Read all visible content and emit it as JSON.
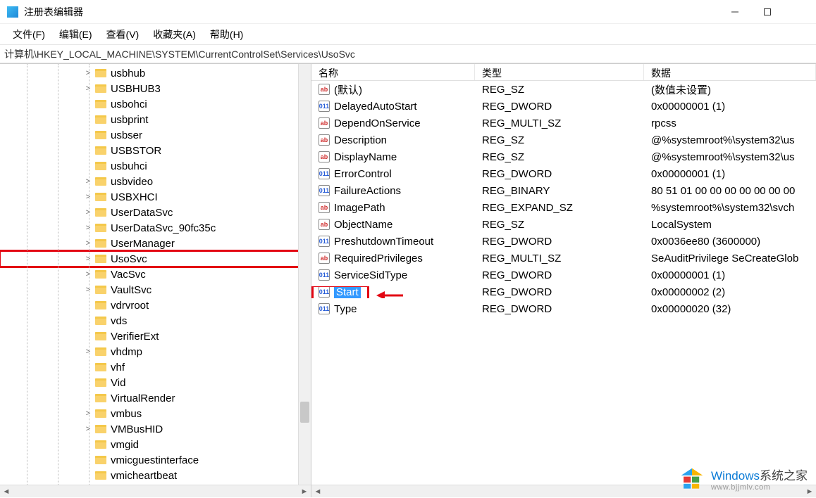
{
  "window": {
    "title": "注册表编辑器"
  },
  "menu": {
    "file": "文件(F)",
    "edit": "编辑(E)",
    "view": "查看(V)",
    "favorites": "收藏夹(A)",
    "help": "帮助(H)"
  },
  "address": "计算机\\HKEY_LOCAL_MACHINE\\SYSTEM\\CurrentControlSet\\Services\\UsoSvc",
  "tree": [
    {
      "label": "usbhub",
      "expander": ">"
    },
    {
      "label": "USBHUB3",
      "expander": ">"
    },
    {
      "label": "usbohci",
      "expander": ""
    },
    {
      "label": "usbprint",
      "expander": ""
    },
    {
      "label": "usbser",
      "expander": ""
    },
    {
      "label": "USBSTOR",
      "expander": ""
    },
    {
      "label": "usbuhci",
      "expander": ""
    },
    {
      "label": "usbvideo",
      "expander": ">"
    },
    {
      "label": "USBXHCI",
      "expander": ">"
    },
    {
      "label": "UserDataSvc",
      "expander": ">"
    },
    {
      "label": "UserDataSvc_90fc35c",
      "expander": ">"
    },
    {
      "label": "UserManager",
      "expander": ">"
    },
    {
      "label": "UsoSvc",
      "expander": ">",
      "highlighted": true
    },
    {
      "label": "VacSvc",
      "expander": ">"
    },
    {
      "label": "VaultSvc",
      "expander": ">"
    },
    {
      "label": "vdrvroot",
      "expander": ""
    },
    {
      "label": "vds",
      "expander": ""
    },
    {
      "label": "VerifierExt",
      "expander": ""
    },
    {
      "label": "vhdmp",
      "expander": ">"
    },
    {
      "label": "vhf",
      "expander": ""
    },
    {
      "label": "Vid",
      "expander": ""
    },
    {
      "label": "VirtualRender",
      "expander": ""
    },
    {
      "label": "vmbus",
      "expander": ">"
    },
    {
      "label": "VMBusHID",
      "expander": ">"
    },
    {
      "label": "vmgid",
      "expander": ""
    },
    {
      "label": "vmicguestinterface",
      "expander": ""
    },
    {
      "label": "vmicheartbeat",
      "expander": ""
    }
  ],
  "columns": {
    "name": "名称",
    "type": "类型",
    "data": "数据"
  },
  "values": [
    {
      "icon": "str",
      "name": "(默认)",
      "type": "REG_SZ",
      "data": "(数值未设置)"
    },
    {
      "icon": "bin",
      "name": "DelayedAutoStart",
      "type": "REG_DWORD",
      "data": "0x00000001 (1)"
    },
    {
      "icon": "str",
      "name": "DependOnService",
      "type": "REG_MULTI_SZ",
      "data": "rpcss"
    },
    {
      "icon": "str",
      "name": "Description",
      "type": "REG_SZ",
      "data": "@%systemroot%\\system32\\us"
    },
    {
      "icon": "str",
      "name": "DisplayName",
      "type": "REG_SZ",
      "data": "@%systemroot%\\system32\\us"
    },
    {
      "icon": "bin",
      "name": "ErrorControl",
      "type": "REG_DWORD",
      "data": "0x00000001 (1)"
    },
    {
      "icon": "bin",
      "name": "FailureActions",
      "type": "REG_BINARY",
      "data": "80 51 01 00 00 00 00 00 00 00"
    },
    {
      "icon": "str",
      "name": "ImagePath",
      "type": "REG_EXPAND_SZ",
      "data": "%systemroot%\\system32\\svch"
    },
    {
      "icon": "str",
      "name": "ObjectName",
      "type": "REG_SZ",
      "data": "LocalSystem"
    },
    {
      "icon": "bin",
      "name": "PreshutdownTimeout",
      "type": "REG_DWORD",
      "data": "0x0036ee80 (3600000)"
    },
    {
      "icon": "str",
      "name": "RequiredPrivileges",
      "type": "REG_MULTI_SZ",
      "data": "SeAuditPrivilege SeCreateGlob"
    },
    {
      "icon": "bin",
      "name": "ServiceSidType",
      "type": "REG_DWORD",
      "data": "0x00000001 (1)"
    },
    {
      "icon": "bin",
      "name": "Start",
      "type": "REG_DWORD",
      "data": "0x00000002 (2)",
      "selected": true
    },
    {
      "icon": "bin",
      "name": "Type",
      "type": "REG_DWORD",
      "data": "0x00000020 (32)"
    }
  ],
  "watermark": {
    "brand_en": "Windows",
    "brand_cn": "系统之家",
    "url": "www.bjjmlv.com"
  }
}
